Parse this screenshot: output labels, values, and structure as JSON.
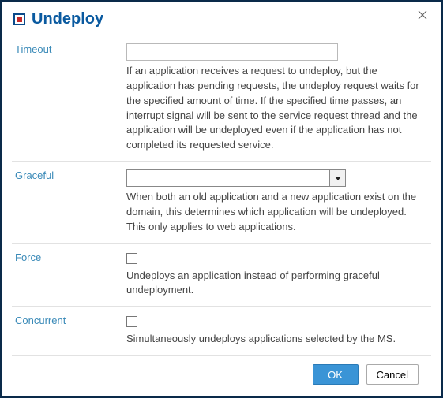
{
  "dialog": {
    "title": "Undeploy"
  },
  "fields": {
    "timeout": {
      "label": "Timeout",
      "value": "",
      "desc": "If an application receives a request to undeploy, but the application has pending requests, the undeploy request waits for the specified amount of time. If the specified time passes, an interrupt signal will be sent to the service request thread and the application will be undeployed even if the application has not completed its requested service."
    },
    "graceful": {
      "label": "Graceful",
      "value": "",
      "desc": "When both an old application and a new application exist on the domain, this determines which application will be undeployed. This only applies to web applications."
    },
    "force": {
      "label": "Force",
      "checked": false,
      "desc": "Undeploys an application instead of performing graceful undeployment."
    },
    "concurrent": {
      "label": "Concurrent",
      "checked": false,
      "desc": "Simultaneously undeploys applications selected by the MS."
    }
  },
  "buttons": {
    "ok": "OK",
    "cancel": "Cancel"
  }
}
